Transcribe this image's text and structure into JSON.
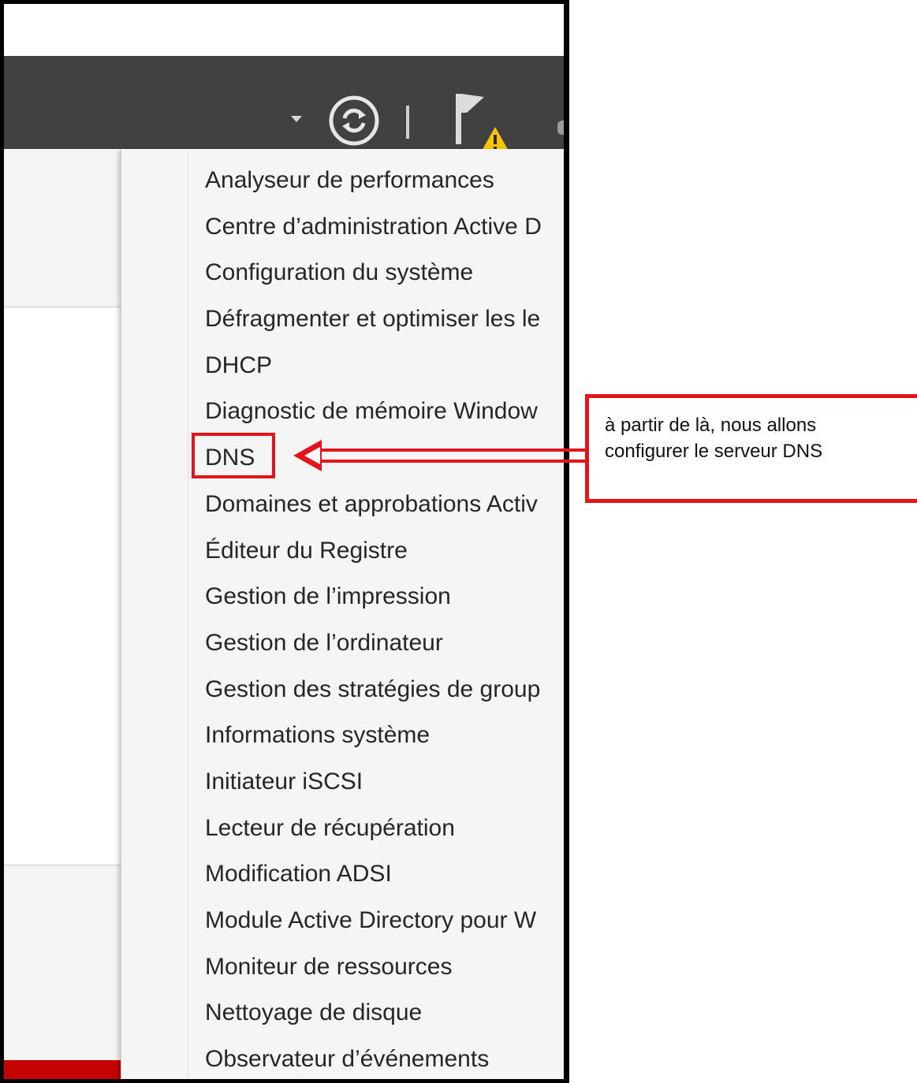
{
  "menu": {
    "items": [
      {
        "label": "Analyseur de performances"
      },
      {
        "label": "Centre d’administration Active D"
      },
      {
        "label": "Configuration du système"
      },
      {
        "label": "Défragmenter et optimiser les le"
      },
      {
        "label": "DHCP"
      },
      {
        "label": "Diagnostic de mémoire Window"
      },
      {
        "label": "DNS"
      },
      {
        "label": "Domaines et approbations Activ"
      },
      {
        "label": "Éditeur du Registre"
      },
      {
        "label": "Gestion de l’impression"
      },
      {
        "label": "Gestion de l’ordinateur"
      },
      {
        "label": "Gestion des stratégies de group"
      },
      {
        "label": "Informations système"
      },
      {
        "label": "Initiateur iSCSI"
      },
      {
        "label": "Lecteur de récupération"
      },
      {
        "label": "Modification ADSI"
      },
      {
        "label": "Module Active Directory pour W"
      },
      {
        "label": "Moniteur de ressources"
      },
      {
        "label": "Nettoyage de disque"
      },
      {
        "label": "Observateur d’événements"
      }
    ],
    "highlighted": "DNS"
  },
  "toolbar": {
    "icons": [
      "dropdown-arrow-icon",
      "refresh-icon",
      "flag-warning-icon"
    ]
  },
  "callout": {
    "text": "à partir de là, nous allons configurer le serveur DNS"
  },
  "colors": {
    "toolbar": "#414141",
    "annotation_red": "#e3141b",
    "menu_bg": "#f5f5f5",
    "warning": "#f7c400"
  }
}
